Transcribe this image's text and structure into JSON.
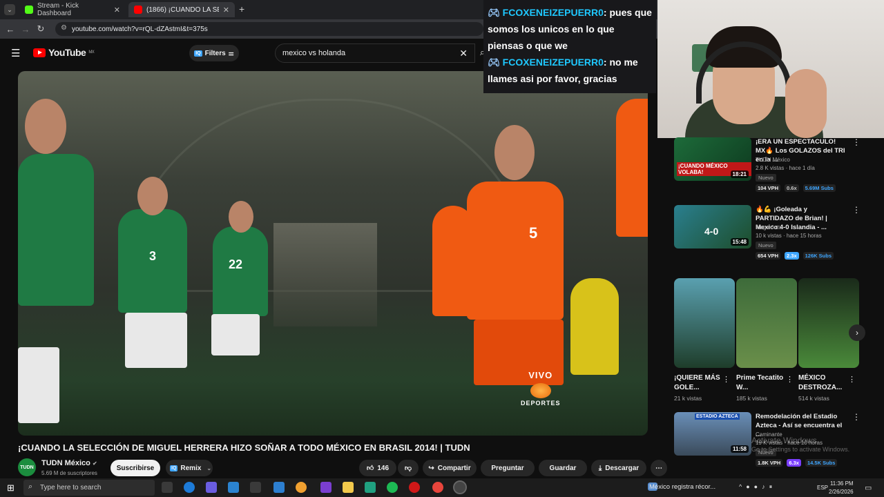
{
  "browser": {
    "tabs": [
      {
        "label": "Stream - Kick Dashboard"
      },
      {
        "label": "(1866) ¡CUANDO LA SELECCIÓ..."
      }
    ],
    "url": "youtube.com/watch?v=rQL-dZAstmI&t=375s"
  },
  "youtube": {
    "logo": "YouTube",
    "region": "MX",
    "filters_label": "Filters",
    "search_value": "mexico vs holanda",
    "video": {
      "title": "¡CUANDO LA SELECCIÓN DE MIGUEL HERRERA HIZO SOÑAR A TODO MÉXICO EN BRASIL 2014! | TUDN",
      "live_tag": "VIVO",
      "live_brand": "DEPORTES",
      "jersey_numbers": [
        "3",
        "22",
        "5"
      ]
    },
    "channel": {
      "avatar_text": "TUDN",
      "name": "TUDN México",
      "subscribers": "5.69 M de suscriptores",
      "subscribe_label": "Suscribirse",
      "remix_label": "Remix"
    },
    "actions": {
      "likes": "146",
      "share": "Compartir",
      "ask": "Preguntar",
      "save": "Guardar",
      "download": "Descargar"
    }
  },
  "chat": {
    "messages": [
      {
        "user": "FCOXENEIZEPUERR0",
        "text": ": pues que somos los unicos en lo que piensas o que we"
      },
      {
        "user": "FCOXENEIZEPUERR0",
        "text": ": no me llames asi por favor, gracias"
      }
    ]
  },
  "sidebar": {
    "items": [
      {
        "title": "¡ERA UN ESPECTACULO! MX🔥 Los GOLAZOS del TRI en la ...",
        "channel": "TUDN México",
        "meta": "2.8 K vistas · hace 1 día",
        "badge": "Nuevo",
        "duration": "18:21",
        "thumb_text": "¡CUANDO MÉXICO VOLABA!",
        "stats": [
          "104 VPH",
          "0.6x",
          "5.69M Subs"
        ]
      },
      {
        "title": "🔥💪 ¡Goleada y PARTIDAZO de Brian! | Mexico 4-0 Islandia - ...",
        "channel": "Mega Jotta",
        "meta": "10 k vistas · hace 15 horas",
        "badge": "Nuevo",
        "duration": "15:48",
        "thumb_text": "4-0",
        "stats": [
          "654 VPH",
          "2.3x",
          "126K Subs"
        ]
      },
      {
        "title": "Remodelación del Estadio Azteca - Así se encuentra el ...",
        "channel": "Caminante",
        "meta": "19 K vistas · hace 10 horas",
        "badge": "Nuevo",
        "duration": "11:58",
        "thumb_text": "ESTADIO AZTECA",
        "stats": [
          "1.8K VPH",
          "6.3x",
          "14.5K Subs"
        ]
      }
    ],
    "shorts": [
      {
        "title": "¡QUIERE MÁS GOLE...",
        "views": "21 k vistas"
      },
      {
        "title": "Prime Tecatito W...",
        "views": "185 k vistas"
      },
      {
        "title": "MÉXICO DESTROZA...",
        "views": "514 k vistas"
      }
    ]
  },
  "watermark": {
    "line1": "Activate Windows",
    "line2": "Go to Settings to activate Windows."
  },
  "taskbar": {
    "search_placeholder": "Type here to search",
    "news": "México registra récor...",
    "lang": "ESP",
    "time": "11:36 PM",
    "date": "2/26/2026"
  }
}
